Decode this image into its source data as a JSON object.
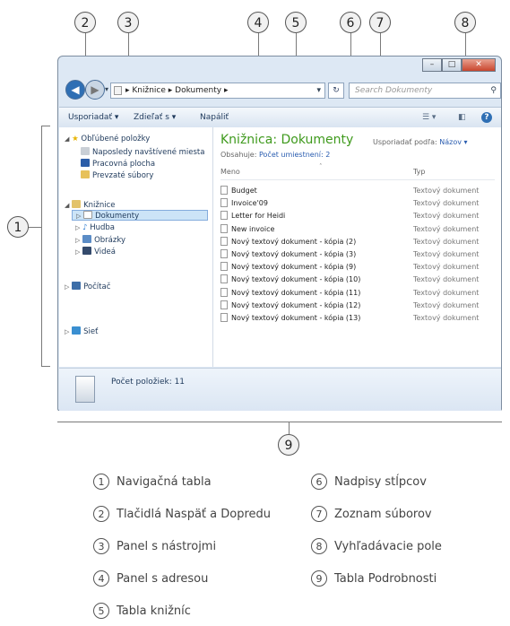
{
  "callouts": [
    "1",
    "2",
    "3",
    "4",
    "5",
    "6",
    "7",
    "8",
    "9"
  ],
  "window": {
    "address": "▸ Knižnice ▸ Dokumenty ▸",
    "search_placeholder": "Search Dokumenty",
    "toolbar": {
      "organize": "Usporiadať ▾",
      "share": "Zdieľať s ▾",
      "burn": "Napáliť"
    },
    "nav": {
      "favorites": "Obľúbené položky",
      "recent": "Naposledy navštívené miesta",
      "desktop": "Pracovná plocha",
      "downloads": "Prevzaté súbory",
      "libraries": "Knižnice",
      "documents": "Dokumenty",
      "music": "Hudba",
      "pictures": "Obrázky",
      "videos": "Videá",
      "computer": "Počítač",
      "network": "Sieť"
    },
    "library": {
      "title": "Knižnica: Dokumenty",
      "includes_label": "Obsahuje:",
      "includes_link": "Počet umiestnení: 2",
      "arrange_label": "Usporiadať podľa:",
      "arrange_value": "Názov ▾"
    },
    "columns": {
      "name": "Meno",
      "type": "Typ"
    },
    "files": [
      {
        "name": "Budget",
        "type": "Textový dokument"
      },
      {
        "name": "Invoice'09",
        "type": "Textový dokument"
      },
      {
        "name": "Letter for Heidi",
        "type": "Textový dokument"
      },
      {
        "name": "New invoice",
        "type": "Textový dokument"
      },
      {
        "name": "Nový textový dokument - kópia (2)",
        "type": "Textový dokument"
      },
      {
        "name": "Nový textový dokument - kópia (3)",
        "type": "Textový dokument"
      },
      {
        "name": "Nový textový dokument - kópia (9)",
        "type": "Textový dokument"
      },
      {
        "name": "Nový textový dokument - kópia (10)",
        "type": "Textový dokument"
      },
      {
        "name": "Nový textový dokument - kópia (11)",
        "type": "Textový dokument"
      },
      {
        "name": "Nový textový dokument - kópia (12)",
        "type": "Textový dokument"
      },
      {
        "name": "Nový textový dokument - kópia (13)",
        "type": "Textový dokument"
      }
    ],
    "details": "Počet položiek: 11"
  },
  "legend": [
    {
      "num": "1",
      "label": "Navigačná tabla"
    },
    {
      "num": "6",
      "label": "Nadpisy stĺpcov"
    },
    {
      "num": "2",
      "label": "Tlačidlá Naspäť a Dopredu"
    },
    {
      "num": "7",
      "label": "Zoznam súborov"
    },
    {
      "num": "3",
      "label": "Panel s nástrojmi"
    },
    {
      "num": "8",
      "label": "Vyhľadávacie pole"
    },
    {
      "num": "4",
      "label": "Panel s adresou"
    },
    {
      "num": "9",
      "label": "Tabla Podrobnosti"
    },
    {
      "num": "5",
      "label": "Tabla knižníc"
    }
  ]
}
